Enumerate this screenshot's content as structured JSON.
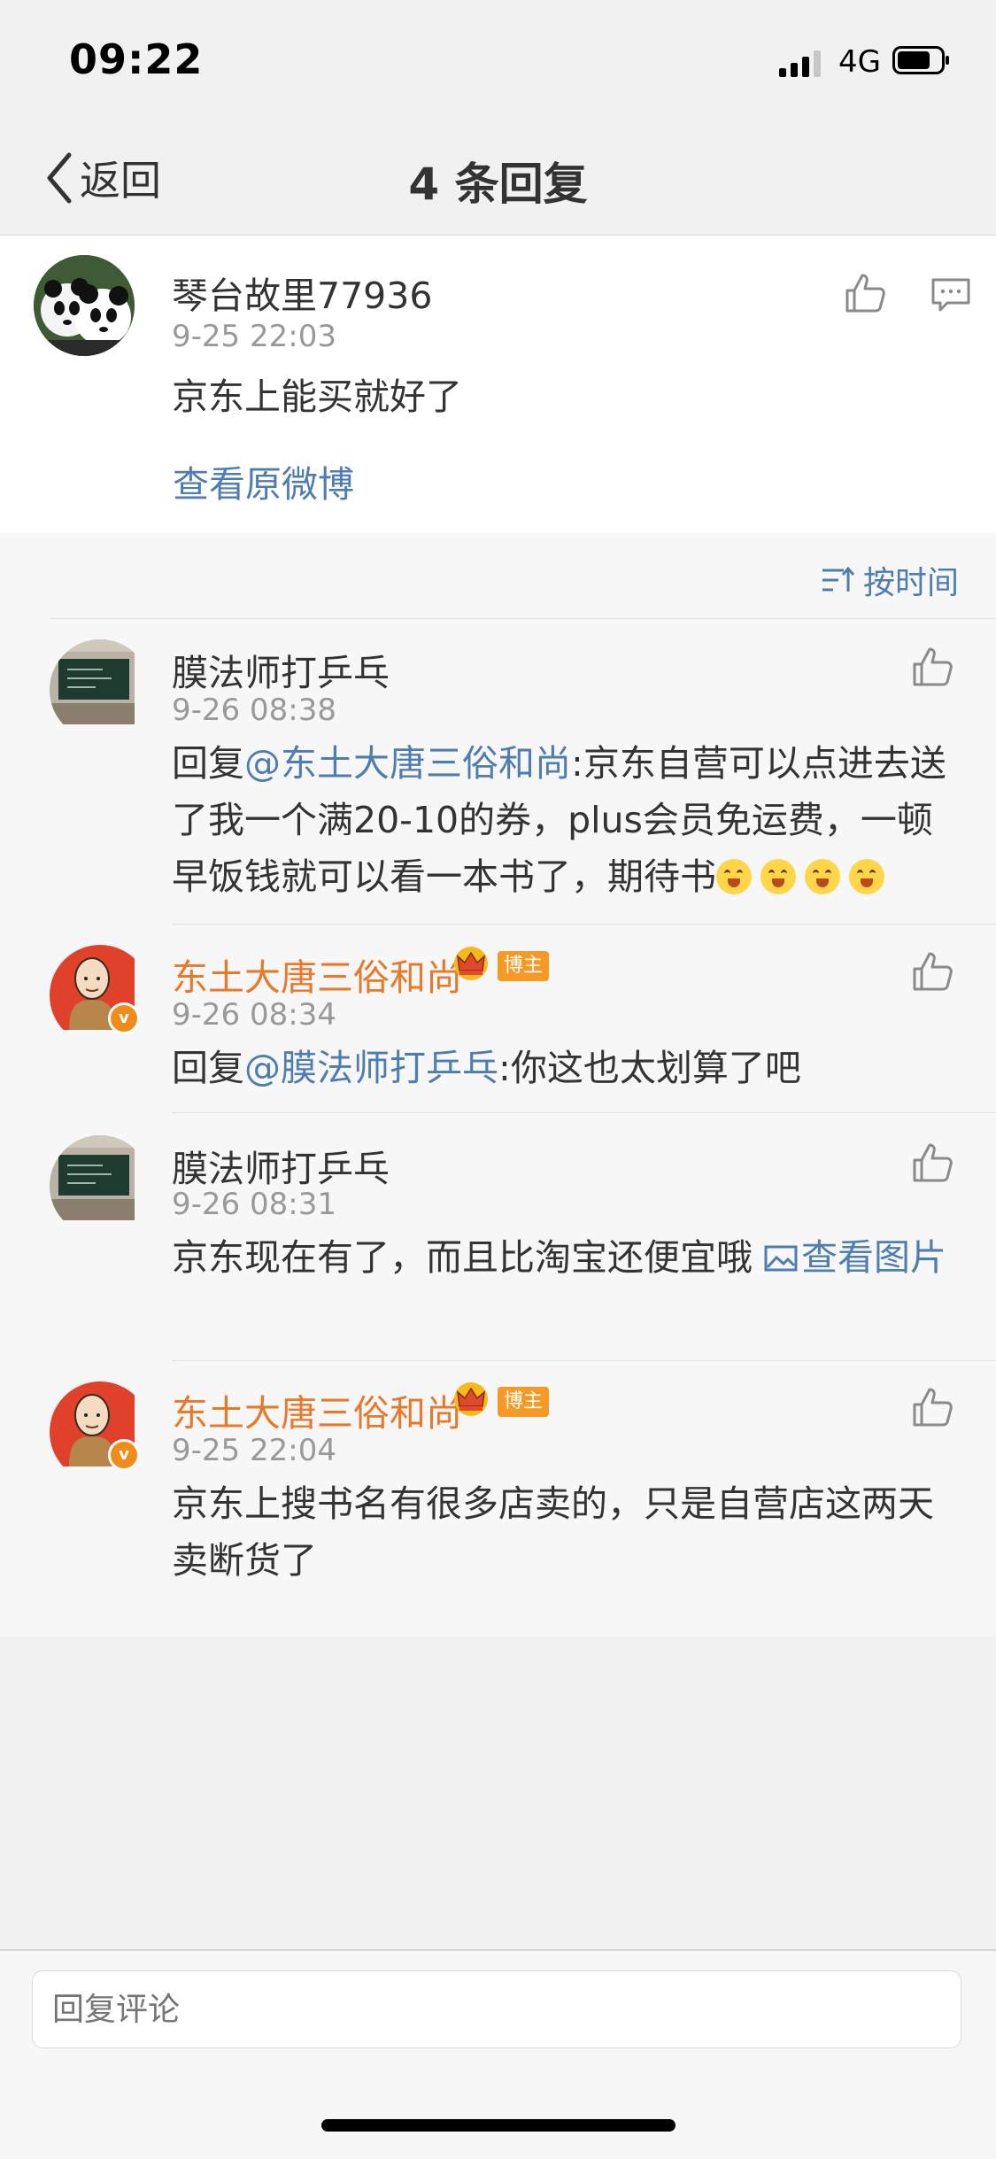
{
  "status": {
    "time": "09:22",
    "network": "4G"
  },
  "nav": {
    "back_label": "返回",
    "title": "4 条回复"
  },
  "main_comment": {
    "author": "琴台故里77936",
    "date": "9-25 22:03",
    "text": "京东上能买就好了",
    "view_original": "查看原微博"
  },
  "sort": {
    "label": "按时间"
  },
  "replies": [
    {
      "author": "膜法师打乒乓",
      "date": "9-26 08:38",
      "prefix": "回复",
      "mention": "@东土大唐三俗和尚",
      "text": ":京东自营可以点进去送了我一个满20-10的券，plus会员免运费，一顿早饭钱就可以看一本书了，期待书"
    },
    {
      "author": "东土大唐三俗和尚",
      "badge": "博主",
      "date": "9-26 08:34",
      "prefix": "回复",
      "mention": "@膜法师打乒乓",
      "text": ":你这也太划算了吧"
    },
    {
      "author": "膜法师打乒乓",
      "date": "9-26 08:31",
      "text": "京东现在有了，而且比淘宝还便宜哦 ",
      "image_link": "查看图片"
    },
    {
      "author": "东土大唐三俗和尚",
      "badge": "博主",
      "date": "9-25 22:04",
      "text": "京东上搜书名有很多店卖的，只是自营店这两天卖断货了"
    }
  ],
  "reply_input": {
    "placeholder": "回复评论"
  },
  "icons": {
    "like": "thumbs-up-icon",
    "comment": "comment-icon",
    "sort": "sort-icon",
    "back": "chevron-left-icon",
    "image": "image-icon",
    "crown": "crown-icon"
  },
  "colors": {
    "link": "#507daf",
    "blogger": "#e8792b",
    "badge": "#f59a25"
  }
}
